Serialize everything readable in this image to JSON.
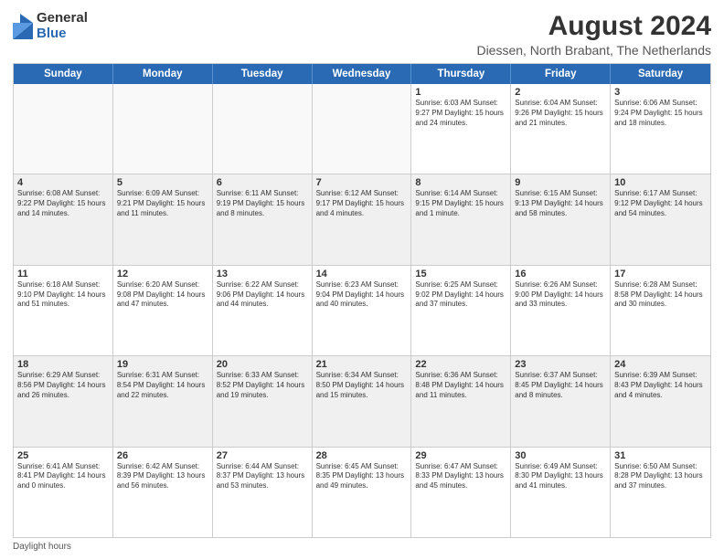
{
  "header": {
    "logo_general": "General",
    "logo_blue": "Blue",
    "month_year": "August 2024",
    "location": "Diessen, North Brabant, The Netherlands"
  },
  "days_of_week": [
    "Sunday",
    "Monday",
    "Tuesday",
    "Wednesday",
    "Thursday",
    "Friday",
    "Saturday"
  ],
  "weeks": [
    [
      {
        "day": "",
        "info": ""
      },
      {
        "day": "",
        "info": ""
      },
      {
        "day": "",
        "info": ""
      },
      {
        "day": "",
        "info": ""
      },
      {
        "day": "1",
        "info": "Sunrise: 6:03 AM\nSunset: 9:27 PM\nDaylight: 15 hours\nand 24 minutes."
      },
      {
        "day": "2",
        "info": "Sunrise: 6:04 AM\nSunset: 9:26 PM\nDaylight: 15 hours\nand 21 minutes."
      },
      {
        "day": "3",
        "info": "Sunrise: 6:06 AM\nSunset: 9:24 PM\nDaylight: 15 hours\nand 18 minutes."
      }
    ],
    [
      {
        "day": "4",
        "info": "Sunrise: 6:08 AM\nSunset: 9:22 PM\nDaylight: 15 hours\nand 14 minutes."
      },
      {
        "day": "5",
        "info": "Sunrise: 6:09 AM\nSunset: 9:21 PM\nDaylight: 15 hours\nand 11 minutes."
      },
      {
        "day": "6",
        "info": "Sunrise: 6:11 AM\nSunset: 9:19 PM\nDaylight: 15 hours\nand 8 minutes."
      },
      {
        "day": "7",
        "info": "Sunrise: 6:12 AM\nSunset: 9:17 PM\nDaylight: 15 hours\nand 4 minutes."
      },
      {
        "day": "8",
        "info": "Sunrise: 6:14 AM\nSunset: 9:15 PM\nDaylight: 15 hours\nand 1 minute."
      },
      {
        "day": "9",
        "info": "Sunrise: 6:15 AM\nSunset: 9:13 PM\nDaylight: 14 hours\nand 58 minutes."
      },
      {
        "day": "10",
        "info": "Sunrise: 6:17 AM\nSunset: 9:12 PM\nDaylight: 14 hours\nand 54 minutes."
      }
    ],
    [
      {
        "day": "11",
        "info": "Sunrise: 6:18 AM\nSunset: 9:10 PM\nDaylight: 14 hours\nand 51 minutes."
      },
      {
        "day": "12",
        "info": "Sunrise: 6:20 AM\nSunset: 9:08 PM\nDaylight: 14 hours\nand 47 minutes."
      },
      {
        "day": "13",
        "info": "Sunrise: 6:22 AM\nSunset: 9:06 PM\nDaylight: 14 hours\nand 44 minutes."
      },
      {
        "day": "14",
        "info": "Sunrise: 6:23 AM\nSunset: 9:04 PM\nDaylight: 14 hours\nand 40 minutes."
      },
      {
        "day": "15",
        "info": "Sunrise: 6:25 AM\nSunset: 9:02 PM\nDaylight: 14 hours\nand 37 minutes."
      },
      {
        "day": "16",
        "info": "Sunrise: 6:26 AM\nSunset: 9:00 PM\nDaylight: 14 hours\nand 33 minutes."
      },
      {
        "day": "17",
        "info": "Sunrise: 6:28 AM\nSunset: 8:58 PM\nDaylight: 14 hours\nand 30 minutes."
      }
    ],
    [
      {
        "day": "18",
        "info": "Sunrise: 6:29 AM\nSunset: 8:56 PM\nDaylight: 14 hours\nand 26 minutes."
      },
      {
        "day": "19",
        "info": "Sunrise: 6:31 AM\nSunset: 8:54 PM\nDaylight: 14 hours\nand 22 minutes."
      },
      {
        "day": "20",
        "info": "Sunrise: 6:33 AM\nSunset: 8:52 PM\nDaylight: 14 hours\nand 19 minutes."
      },
      {
        "day": "21",
        "info": "Sunrise: 6:34 AM\nSunset: 8:50 PM\nDaylight: 14 hours\nand 15 minutes."
      },
      {
        "day": "22",
        "info": "Sunrise: 6:36 AM\nSunset: 8:48 PM\nDaylight: 14 hours\nand 11 minutes."
      },
      {
        "day": "23",
        "info": "Sunrise: 6:37 AM\nSunset: 8:45 PM\nDaylight: 14 hours\nand 8 minutes."
      },
      {
        "day": "24",
        "info": "Sunrise: 6:39 AM\nSunset: 8:43 PM\nDaylight: 14 hours\nand 4 minutes."
      }
    ],
    [
      {
        "day": "25",
        "info": "Sunrise: 6:41 AM\nSunset: 8:41 PM\nDaylight: 14 hours\nand 0 minutes."
      },
      {
        "day": "26",
        "info": "Sunrise: 6:42 AM\nSunset: 8:39 PM\nDaylight: 13 hours\nand 56 minutes."
      },
      {
        "day": "27",
        "info": "Sunrise: 6:44 AM\nSunset: 8:37 PM\nDaylight: 13 hours\nand 53 minutes."
      },
      {
        "day": "28",
        "info": "Sunrise: 6:45 AM\nSunset: 8:35 PM\nDaylight: 13 hours\nand 49 minutes."
      },
      {
        "day": "29",
        "info": "Sunrise: 6:47 AM\nSunset: 8:33 PM\nDaylight: 13 hours\nand 45 minutes."
      },
      {
        "day": "30",
        "info": "Sunrise: 6:49 AM\nSunset: 8:30 PM\nDaylight: 13 hours\nand 41 minutes."
      },
      {
        "day": "31",
        "info": "Sunrise: 6:50 AM\nSunset: 8:28 PM\nDaylight: 13 hours\nand 37 minutes."
      }
    ]
  ],
  "footer": {
    "note": "Daylight hours"
  }
}
